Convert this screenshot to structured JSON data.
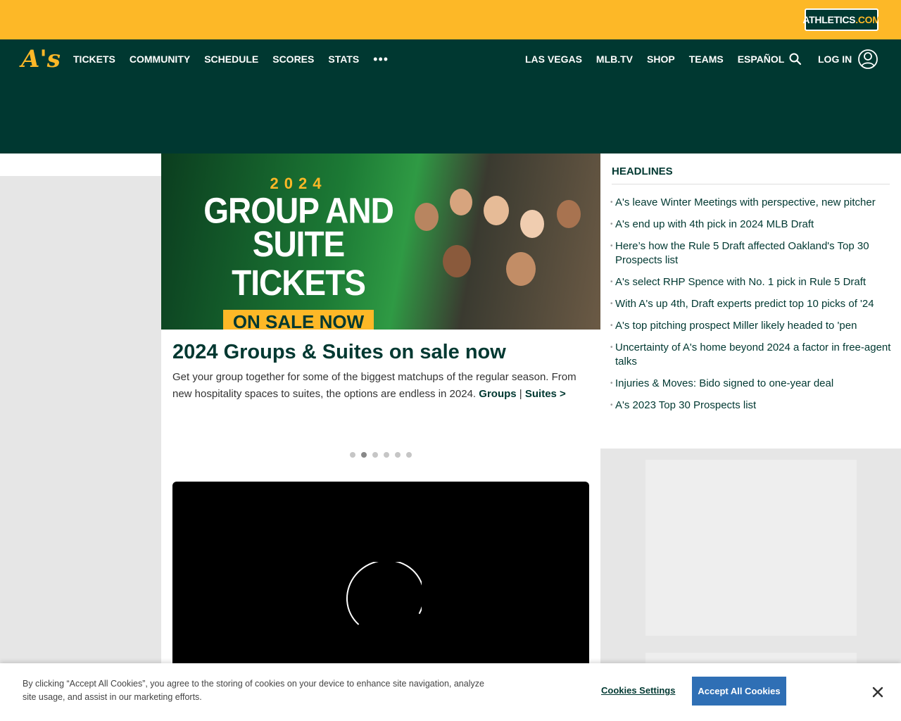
{
  "brand": {
    "badge_prefix": "ATHLETICS",
    "badge_suffix": ".COM",
    "logo_text": "A's",
    "colors": {
      "green": "#003831",
      "gold": "#fdb827",
      "accept_blue": "#2f6fb5"
    }
  },
  "nav": {
    "left": [
      "TICKETS",
      "COMMUNITY",
      "SCHEDULE",
      "SCORES",
      "STATS"
    ],
    "more": "•••",
    "right": [
      "LAS VEGAS",
      "MLB.TV",
      "SHOP",
      "TEAMS",
      "ESPAÑOL"
    ],
    "login": "LOG IN"
  },
  "hero": {
    "year": "2024",
    "line1": "GROUP AND",
    "line2": "SUITE TICKETS",
    "sale": "ON SALE NOW"
  },
  "story": {
    "headline": "2024 Groups & Suites on sale now",
    "desc": "Get your group together for some of the biggest matchups of the regular season. From new hospitality spaces to suites, the options are endless in 2024.",
    "link_groups": "Groups",
    "separator": " | ",
    "link_suites": "Suites >"
  },
  "carousel": {
    "count": 6,
    "active": 1
  },
  "headlines": {
    "title": "HEADLINES",
    "items": [
      "A's leave Winter Meetings with perspective, new pitcher",
      "A's end up with 4th pick in 2024 MLB Draft",
      "Here’s how the Rule 5 Draft affected Oakland's Top 30 Prospects list",
      "A's select RHP Spence with No. 1 pick in Rule 5 Draft",
      "With A's up 4th, Draft experts predict top 10 picks of '24",
      "A's top pitching prospect Miller likely headed to 'pen",
      "Uncertainty of A's home beyond 2024 a factor in free-agent talks",
      "Injuries & Moves: Bido signed to one-year deal",
      "A's 2023 Top 30 Prospects list"
    ]
  },
  "cookie": {
    "text": "By clicking “Accept All Cookies”, you agree to the storing of cookies on your device to enhance site navigation, analyze site usage, and assist in our marketing efforts.",
    "settings": "Cookies Settings",
    "accept": "Accept All Cookies"
  }
}
